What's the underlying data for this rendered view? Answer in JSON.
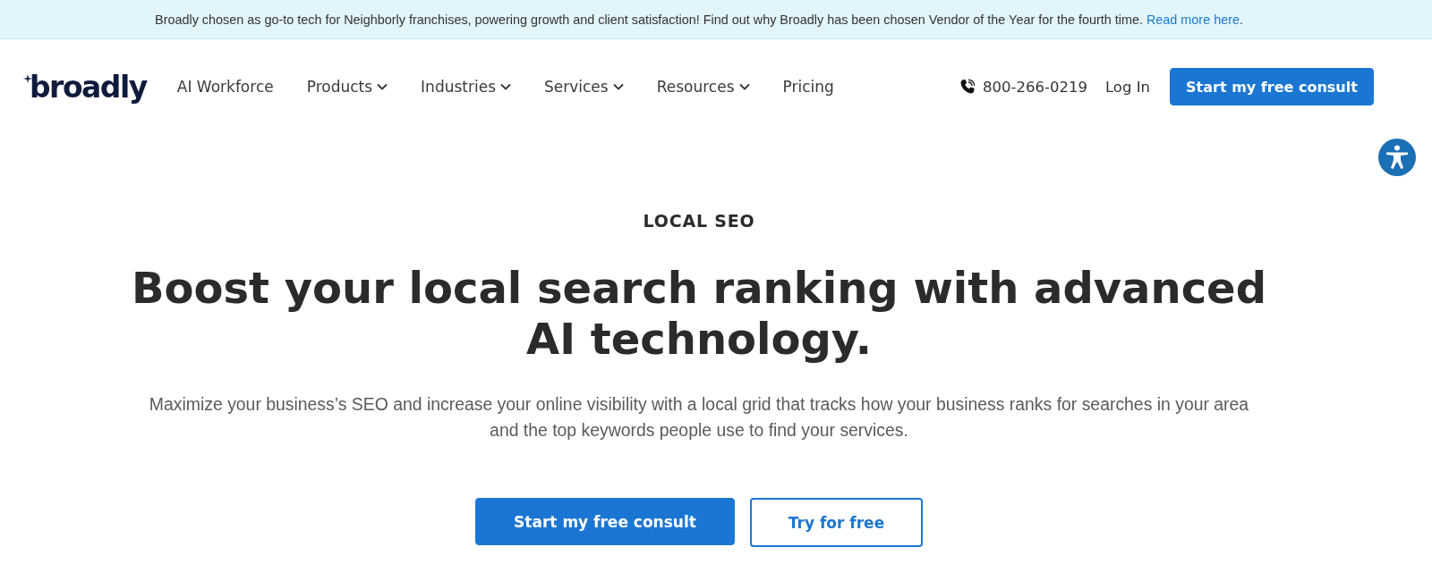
{
  "announcement": {
    "text": "Broadly chosen as go-to tech for Neighborly franchises, powering growth and client satisfaction! Find out why Broadly has been chosen Vendor of the Year for the fourth time.",
    "link": "Read more here",
    "end": "."
  },
  "nav": {
    "logo": "broadly",
    "items": [
      {
        "label": "AI Workforce",
        "dropdown": false
      },
      {
        "label": "Products",
        "dropdown": true
      },
      {
        "label": "Industries",
        "dropdown": true
      },
      {
        "label": "Services",
        "dropdown": true
      },
      {
        "label": "Resources",
        "dropdown": true
      },
      {
        "label": "Pricing",
        "dropdown": false
      }
    ],
    "phone": "800-266-0219",
    "login": "Log In",
    "cta": "Start my free consult"
  },
  "hero": {
    "eyebrow": "LOCAL SEO",
    "title": "Boost your local search ranking with advanced AI technology.",
    "description": "Maximize your business’s SEO and increase your online visibility with a local grid that tracks how your business ranks for searches in your area and the top keywords people use to find your services.",
    "buttons": [
      {
        "label": "Start my free consult",
        "kind": "primary"
      },
      {
        "label": "Try for free",
        "kind": "outline"
      }
    ]
  }
}
